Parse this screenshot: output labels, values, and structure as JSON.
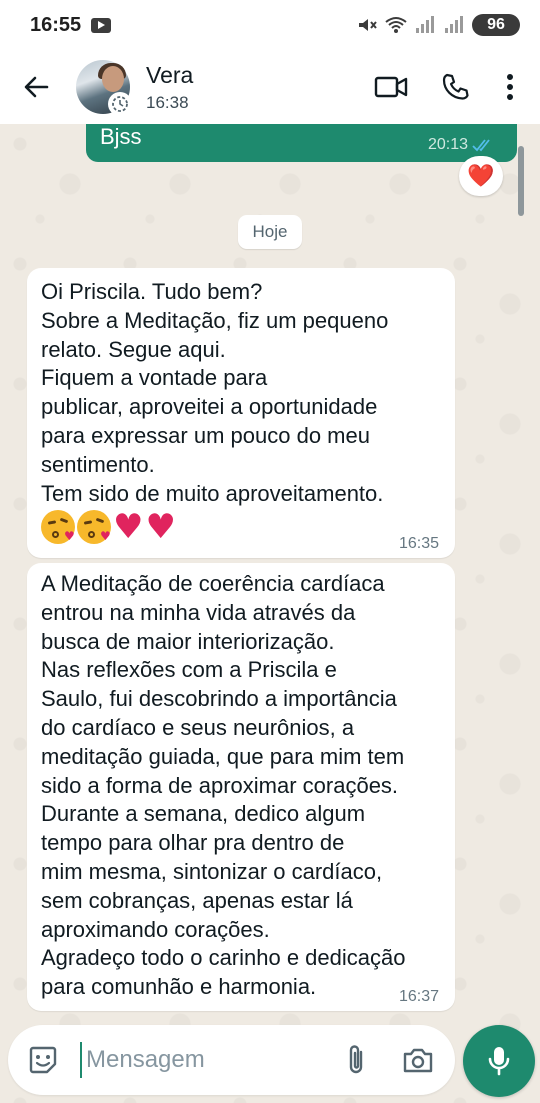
{
  "status_bar": {
    "time": "16:55",
    "battery": "96"
  },
  "header": {
    "contact_name": "Vera",
    "contact_subtitle": "16:38"
  },
  "messages": {
    "outgoing": {
      "text": "Bjss",
      "time": "20:13",
      "reaction": "❤️"
    },
    "date_chip": "Hoje",
    "incoming_1": {
      "text": "Oi Priscila. Tudo bem?\nSobre a Meditação, fiz um pequeno\nrelato. Segue aqui.\nFiquem a vontade para\npublicar, aproveitei a oportunidade\npara expressar um pouco do meu\nsentimento.\nTem sido de muito aproveitamento.",
      "emojis": [
        "kiss-face",
        "kiss-face",
        "red-heart",
        "red-heart"
      ],
      "time": "16:35"
    },
    "incoming_2": {
      "text": "A Meditação de coerência cardíaca\nentrou na minha vida através da\nbusca de maior interiorização.\nNas reflexões com a Priscila e\nSaulo, fui descobrindo a importância\ndo cardíaco e seus neurônios, a\nmeditação guiada, que para mim tem\nsido a forma de aproximar corações.\nDurante a semana, dedico algum\ntempo para olhar pra dentro de\nmim mesma, sintonizar o cardíaco,\nsem cobranças, apenas estar lá\naproximando corações.\nAgradeço todo o carinho e dedicação\npara comunhão e harmonia.",
      "time": "16:37"
    }
  },
  "composer": {
    "placeholder": "Mensagem"
  },
  "colors": {
    "accent": "#1e8a6e",
    "chat_background": "#efeae2",
    "bubble_in": "#ffffff",
    "read_ticks": "#53bdeb"
  },
  "icons": [
    "back-arrow-icon",
    "video-call-icon",
    "phone-icon",
    "more-options-icon",
    "emoji-icon",
    "attach-icon",
    "camera-icon",
    "mic-icon",
    "double-check-icon",
    "youtube-icon",
    "mute-icon",
    "wifi-icon",
    "signal-icon"
  ]
}
